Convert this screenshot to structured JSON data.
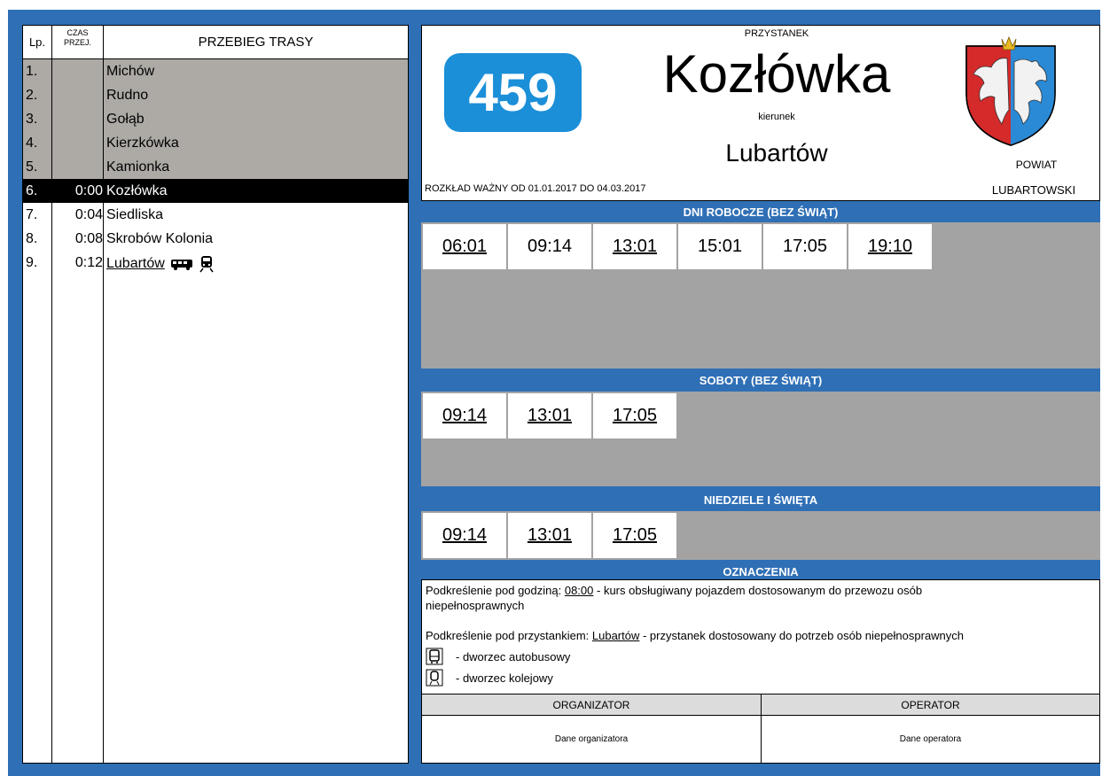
{
  "route": {
    "headers": {
      "lp": "Lp.",
      "czas_line1": "CZAS",
      "czas_line2": "PRZEJ.",
      "przebieg": "PRZEBIEG TRASY"
    },
    "stops": [
      {
        "n": "1.",
        "t": "",
        "name": "Michów",
        "state": "past"
      },
      {
        "n": "2.",
        "t": "",
        "name": "Rudno",
        "state": "past"
      },
      {
        "n": "3.",
        "t": "",
        "name": "Gołąb",
        "state": "past"
      },
      {
        "n": "4.",
        "t": "",
        "name": "Kierzkówka",
        "state": "past"
      },
      {
        "n": "5.",
        "t": "",
        "name": "Kamionka",
        "state": "past"
      },
      {
        "n": "6.",
        "t": "0:00",
        "name": "Kozłówka",
        "state": "current"
      },
      {
        "n": "7.",
        "t": "0:04",
        "name": "Siedliska",
        "state": "next"
      },
      {
        "n": "8.",
        "t": "0:08",
        "name": "Skrobów Kolonia",
        "state": "next"
      },
      {
        "n": "9.",
        "t": "0:12",
        "name": "Lubartów",
        "state": "next"
      }
    ],
    "last_stop_icons": [
      "bus-station-icon",
      "train-station-icon"
    ]
  },
  "header": {
    "line": "459",
    "stop_label": "PRZYSTANEK",
    "stop_name": "Kozłówka",
    "direction_label": "kierunek",
    "direction": "Lubartów",
    "valid": "ROZKŁAD WAŻNY OD 01.01.2017 DO 04.03.2017",
    "powiat_line1": "POWIAT",
    "powiat_line2": "LUBARTOWSKI",
    "crest_icon": "coat-of-arms-icon"
  },
  "timetable": {
    "weekdays_title": "DNI ROBOCZE (BEZ ŚWIĄT)",
    "weekdays": [
      "06:01",
      "09:14",
      "13:01",
      "15:01",
      "17:05",
      "19:10"
    ],
    "weekdays_underlined": [
      true,
      false,
      true,
      false,
      false,
      true
    ],
    "saturdays_title": "SOBOTY (BEZ ŚWIĄT)",
    "saturdays": [
      "09:14",
      "13:01",
      "17:05"
    ],
    "sundays_title": "NIEDZIELE I ŚWIĘTA",
    "sundays": [
      "09:14",
      "13:01",
      "17:05"
    ]
  },
  "notes": {
    "title": "OZNACZENIA",
    "n1_a": "Podkreślenie pod godziną: ",
    "n1_b": "08:00",
    "n1_c": " - kurs obsługiwany pojazdem dostosowanym do przewozu osób",
    "n1_d": "niepełnosprawnych",
    "n2_a": "Podkreślenie pod przystankiem: ",
    "n2_b": "Lubartów",
    "n2_c": " - przystanek dostosowany do potrzeb osób niepełnosprawnych",
    "bus": "- dworzec autobusowy",
    "train": "- dworzec kolejowy",
    "organizer_label": "ORGANIZATOR",
    "operator_label": "OPERATOR",
    "organizer": "Dane organizatora",
    "operator": "Dane operatora"
  },
  "colors": {
    "frame": "#2f6fb5",
    "line_badge": "#1b8fd8",
    "past_row": "#adaaa6",
    "empty_cells": "#a3a3a3"
  }
}
